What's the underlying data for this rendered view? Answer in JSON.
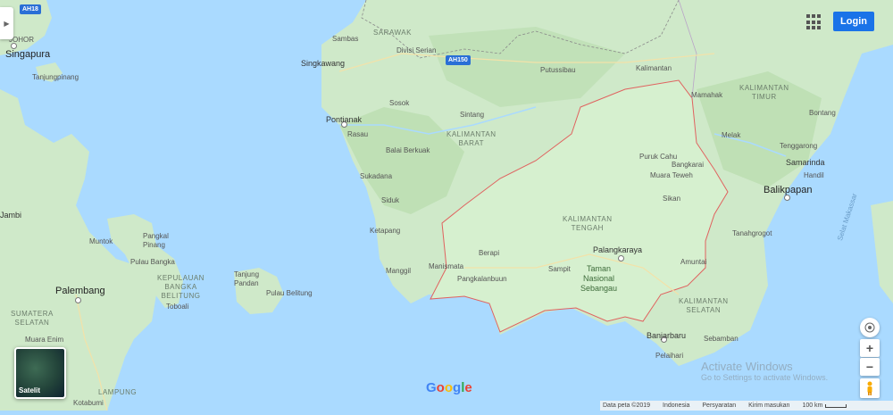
{
  "map": {
    "colors": {
      "water": "#aadaff",
      "land": "#cfe9c9",
      "forest": "#b8dcad",
      "highlight": "#d6f0cf",
      "border": "#e0625f"
    },
    "labels": {
      "singapura": "Singapura",
      "johor": "JOHOR",
      "tanjungpinang": "Tanjungpinang",
      "sambas": "Sambas",
      "singkawang": "Singkawang",
      "pontianak": "Pontianak",
      "rasau": "Rasau",
      "sosok": "Sosok",
      "sintang": "Sintang",
      "balai_berkuak": "Balai Berkuak",
      "sukadana": "Sukadana",
      "siduk": "Siduk",
      "ketapang": "Ketapang",
      "manggil": "Manggil",
      "manismata": "Manismata",
      "sarawak": "SARAWAK",
      "divisi_serian": "Divisi Serian",
      "putussibau": "Putussibau",
      "kalimantan": "Kalimantan",
      "mamahak": "Mamahak",
      "bontang": "Bontang",
      "tenggarong": "Tenggarong",
      "samarinda": "Samarinda",
      "balikpapan": "Balikpapan",
      "handil": "Handil",
      "melak": "Melak",
      "tanahgrogot": "Tanahgrogot",
      "puruk_cahu": "Puruk Cahu",
      "bangkarai": "Bangkarai",
      "muara_teweh": "Muara Teweh",
      "sikan": "Sikan",
      "palangkaraya": "Palangkaraya",
      "amuntai": "Amuntai",
      "berapi": "Berapi",
      "sampit": "Sampit",
      "pangkalan_bun": "Pangkalanbuun",
      "banjarbaru": "Banjarbaru",
      "pelaihari": "Pelaihari",
      "sebamban": "Sebamban",
      "tengah": "Tengah",
      "jambi": "Jambi",
      "muntok": "Muntok",
      "pangkal_pinang": "Pangkal\nPinang",
      "pulau_bangka": "Pulau Bangka",
      "kepulauan": "KEPULAUAN\nBANGKA\nBELITUNG",
      "toboali": "Toboali",
      "tanjung_pandan": "Tanjung\nPandan",
      "pulau_belitung": "Pulau Belitung",
      "palembang": "Palembang",
      "sumatera_selatan": "SUMATERA\nSELATAN",
      "muara_enim": "Muara Enim",
      "lampung": "LAMPUNG",
      "kotabumi": "Kotabumi",
      "kalbar": "KALIMANTAN\nBARAT",
      "kalteng": "KALIMANTAN\nTENGAH",
      "kaltim": "KALIMANTAN\nTIMUR",
      "kalsel": "KALIMANTAN\nSELATAN",
      "taman": "Taman\nNasional\nSebangau",
      "selat_makassar": "Selat Makassar"
    },
    "roads": {
      "ah18": "AH18",
      "ah150": "AH150"
    }
  },
  "controls": {
    "login": "Login",
    "zoom_in": "+",
    "zoom_out": "−",
    "satellite": "Satelit",
    "google": [
      "G",
      "o",
      "o",
      "g",
      "l",
      "e"
    ],
    "google_colors": [
      "#4285f4",
      "#ea4335",
      "#fbbc05",
      "#4285f4",
      "#34a853",
      "#ea4335"
    ]
  },
  "footer": {
    "data": "Data peta ©2019",
    "indonesia": "Indonesia",
    "terms": "Persyaratan",
    "feedback": "Kirim masukan",
    "scale": "100 km"
  },
  "watermark": {
    "title": "Activate Windows",
    "subtitle": "Go to Settings to activate Windows."
  }
}
